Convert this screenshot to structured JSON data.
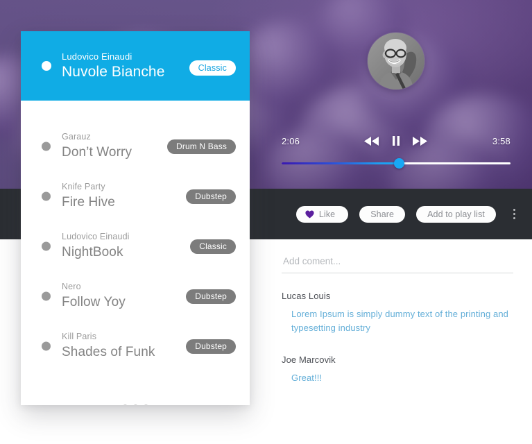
{
  "player": {
    "current_time": "2:06",
    "total_time": "3:58",
    "progress_percent": 51.5,
    "controls": {
      "rewind": "rewind-icon",
      "pause": "pause-icon",
      "forward": "forward-icon"
    },
    "avatar_alt": "user-avatar"
  },
  "actionbar": {
    "like_label": "Like",
    "share_label": "Share",
    "playlist_label": "Add to play list",
    "heart_icon": "heart-icon",
    "more_icon": "kebab-menu-icon",
    "accent_purple": "#5b1f9e",
    "background": "#2b2e33"
  },
  "comments": {
    "placeholder": "Add coment...",
    "input_value": "",
    "items": [
      {
        "author": "Lucas Louis",
        "text": "Lorem Ipsum is simply dummy text of the printing and typesetting industry"
      },
      {
        "author": "Joe Marcovik",
        "text": "Great!!!"
      }
    ]
  },
  "playlist": {
    "more_label": "more-tracks",
    "active_color": "#10ace5",
    "tracks": [
      {
        "artist": "Ludovico Einaudi",
        "title": "Nuvole Bianche",
        "tag": "Classic",
        "active": true
      },
      {
        "artist": "Garauz",
        "title": "Don’t Worry",
        "tag": "Drum N Bass",
        "active": false
      },
      {
        "artist": "Knife Party",
        "title": "Fire Hive",
        "tag": "Dubstep",
        "active": false
      },
      {
        "artist": "Ludovico Einaudi",
        "title": "NightBook",
        "tag": "Classic",
        "active": false
      },
      {
        "artist": "Nero",
        "title": "Follow Yoy",
        "tag": "Dubstep",
        "active": false
      },
      {
        "artist": "Kill Paris",
        "title": "Shades of Funk",
        "tag": "Dubstep",
        "active": false
      }
    ]
  }
}
